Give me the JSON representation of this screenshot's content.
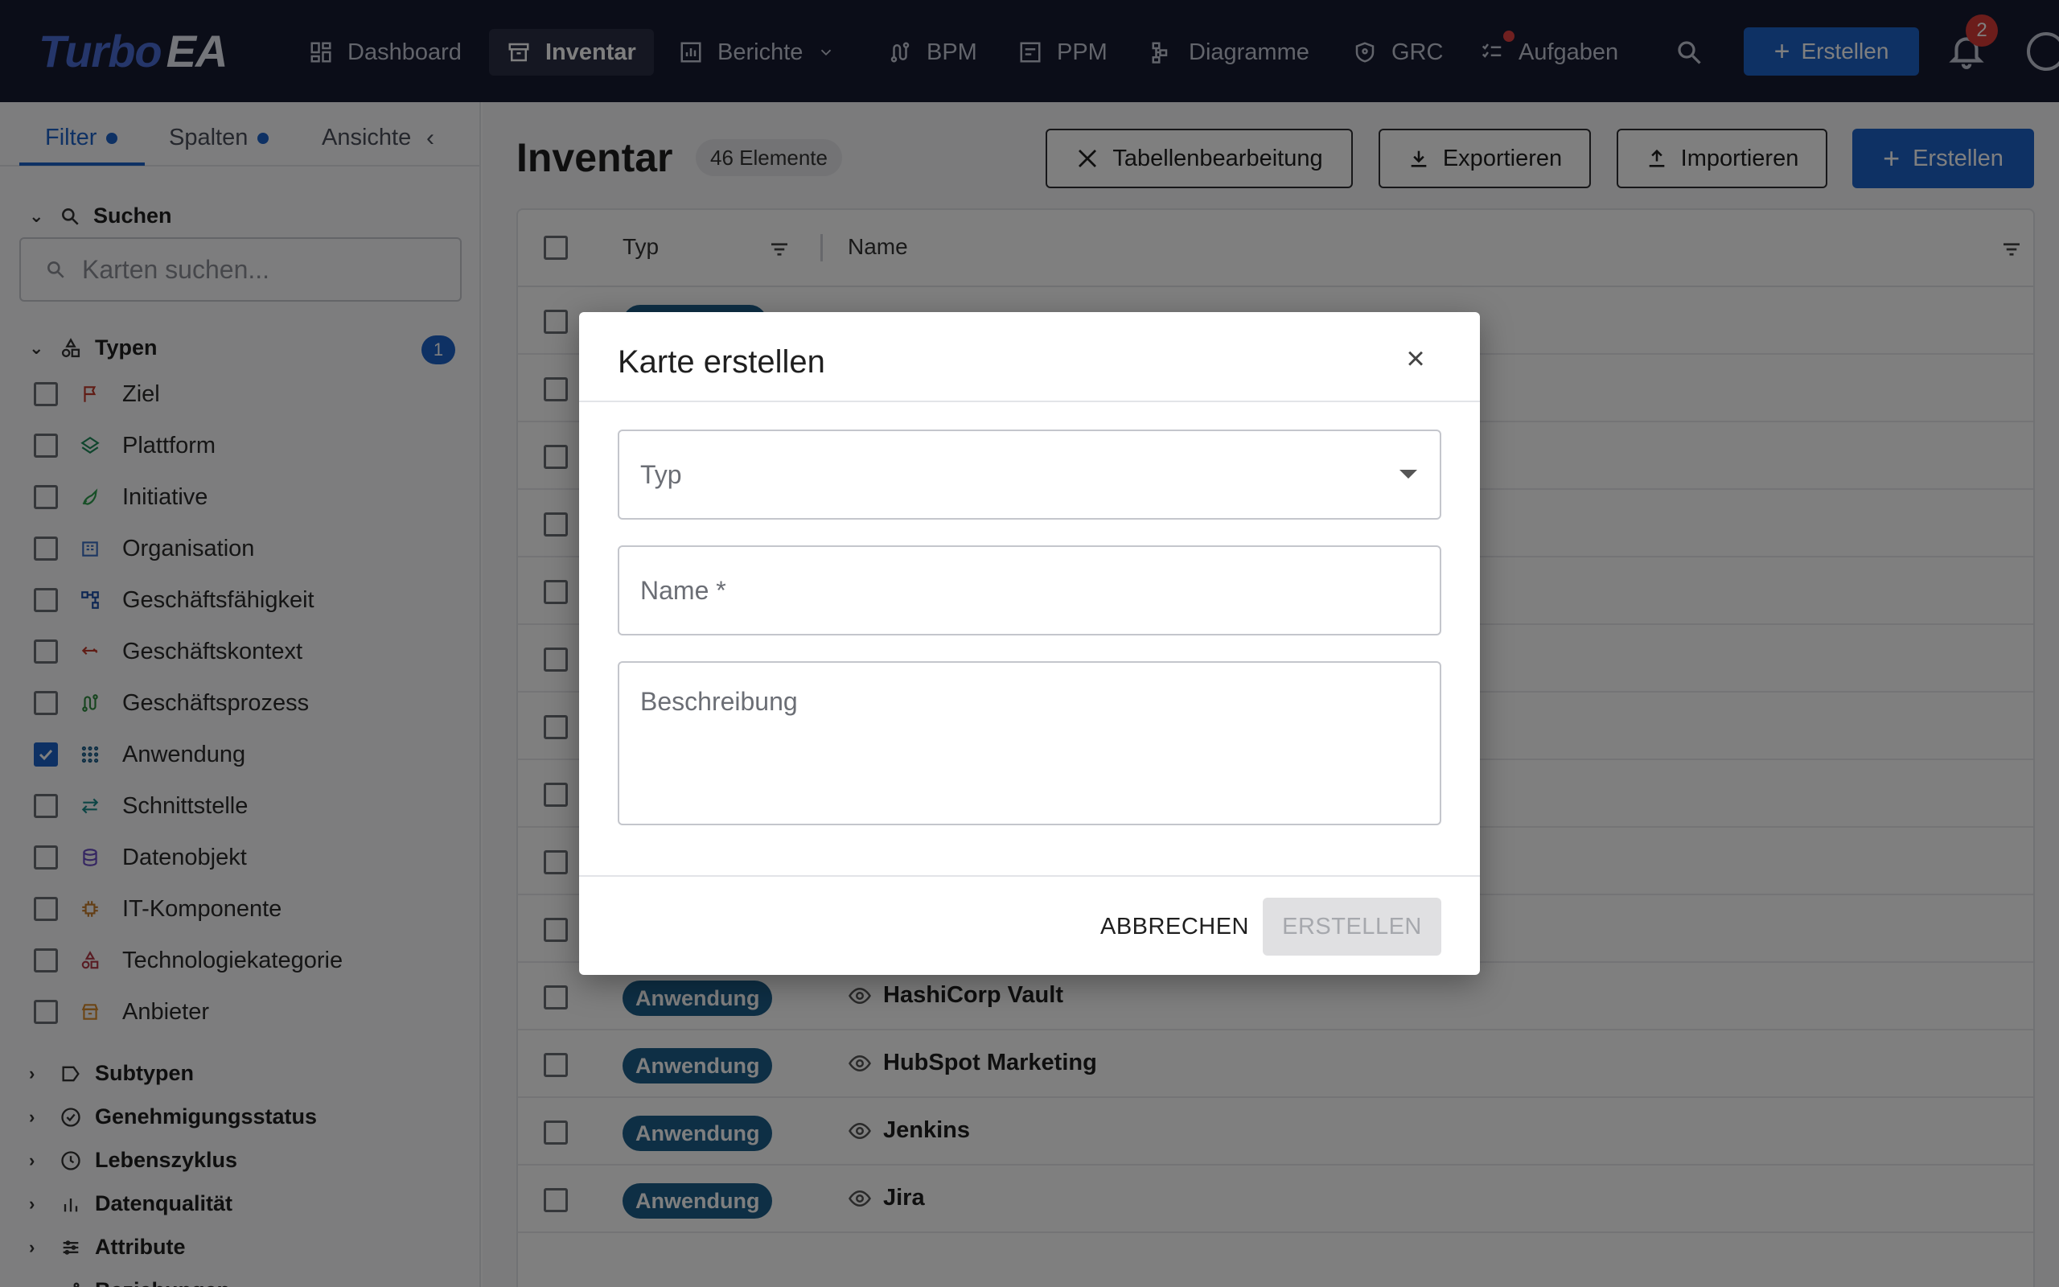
{
  "app": {
    "logo_part1": "Turbo",
    "logo_part2": "EA"
  },
  "nav": {
    "items": [
      {
        "label": "Dashboard",
        "icon": "dashboard-icon"
      },
      {
        "label": "Inventar",
        "icon": "archive-icon"
      },
      {
        "label": "Berichte",
        "icon": "chart-icon"
      },
      {
        "label": "BPM",
        "icon": "route-icon"
      },
      {
        "label": "PPM",
        "icon": "board-icon"
      },
      {
        "label": "Diagramme",
        "icon": "diagram-icon"
      },
      {
        "label": "GRC",
        "icon": "shield-icon"
      },
      {
        "label": "Aufgaben",
        "icon": "tasks-icon"
      }
    ],
    "create_label": "Erstellen",
    "notification_count": "2"
  },
  "sidebar": {
    "tabs": [
      {
        "label": "Filter"
      },
      {
        "label": "Spalten"
      },
      {
        "label": "Ansichte"
      }
    ],
    "search_title": "Suchen",
    "search_placeholder": "Karten suchen...",
    "types_title": "Typen",
    "types_count": "1",
    "types": [
      {
        "label": "Ziel",
        "color": "#c0392b",
        "checked": false
      },
      {
        "label": "Plattform",
        "color": "#1f8a5a",
        "checked": false
      },
      {
        "label": "Initiative",
        "color": "#2e9e4f",
        "checked": false
      },
      {
        "label": "Organisation",
        "color": "#3a6fc4",
        "checked": false
      },
      {
        "label": "Geschäftsfähigkeit",
        "color": "#1d4fa8",
        "checked": false
      },
      {
        "label": "Geschäftskontext",
        "color": "#c0392b",
        "checked": false
      },
      {
        "label": "Geschäftsprozess",
        "color": "#2e8a3e",
        "checked": false
      },
      {
        "label": "Anwendung",
        "color": "#1d5f8a",
        "checked": true
      },
      {
        "label": "Schnittstelle",
        "color": "#1a8a8a",
        "checked": false
      },
      {
        "label": "Datenobjekt",
        "color": "#6a4cc4",
        "checked": false
      },
      {
        "label": "IT-Komponente",
        "color": "#c77d2a",
        "checked": false
      },
      {
        "label": "Technologiekategorie",
        "color": "#b23a48",
        "checked": false
      },
      {
        "label": "Anbieter",
        "color": "#d98a2a",
        "checked": false
      }
    ],
    "sections": [
      {
        "label": "Subtypen"
      },
      {
        "label": "Genehmigungsstatus"
      },
      {
        "label": "Lebenszyklus"
      },
      {
        "label": "Datenqualität"
      },
      {
        "label": "Attribute"
      },
      {
        "label": "Beziehungen"
      }
    ]
  },
  "main": {
    "title": "Inventar",
    "count_badge": "46 Elemente",
    "buttons": {
      "table_edit": "Tabellenbearbeitung",
      "export": "Exportieren",
      "import": "Importieren",
      "create": "Erstellen"
    },
    "table": {
      "columns": [
        "Typ",
        "Name"
      ],
      "rows": [
        {
          "type": "Anwendung",
          "name": "HashiCorp Vault"
        },
        {
          "type": "Anwendung",
          "name": "HubSpot Marketing"
        },
        {
          "type": "Anwendung",
          "name": "Jenkins"
        },
        {
          "type": "Anwendung",
          "name": "Jira"
        }
      ]
    }
  },
  "modal": {
    "title": "Karte erstellen",
    "type_placeholder": "Typ",
    "name_placeholder": "Name *",
    "description_placeholder": "Beschreibung",
    "cancel_label": "ABBRECHEN",
    "create_label": "ERSTELLEN"
  }
}
